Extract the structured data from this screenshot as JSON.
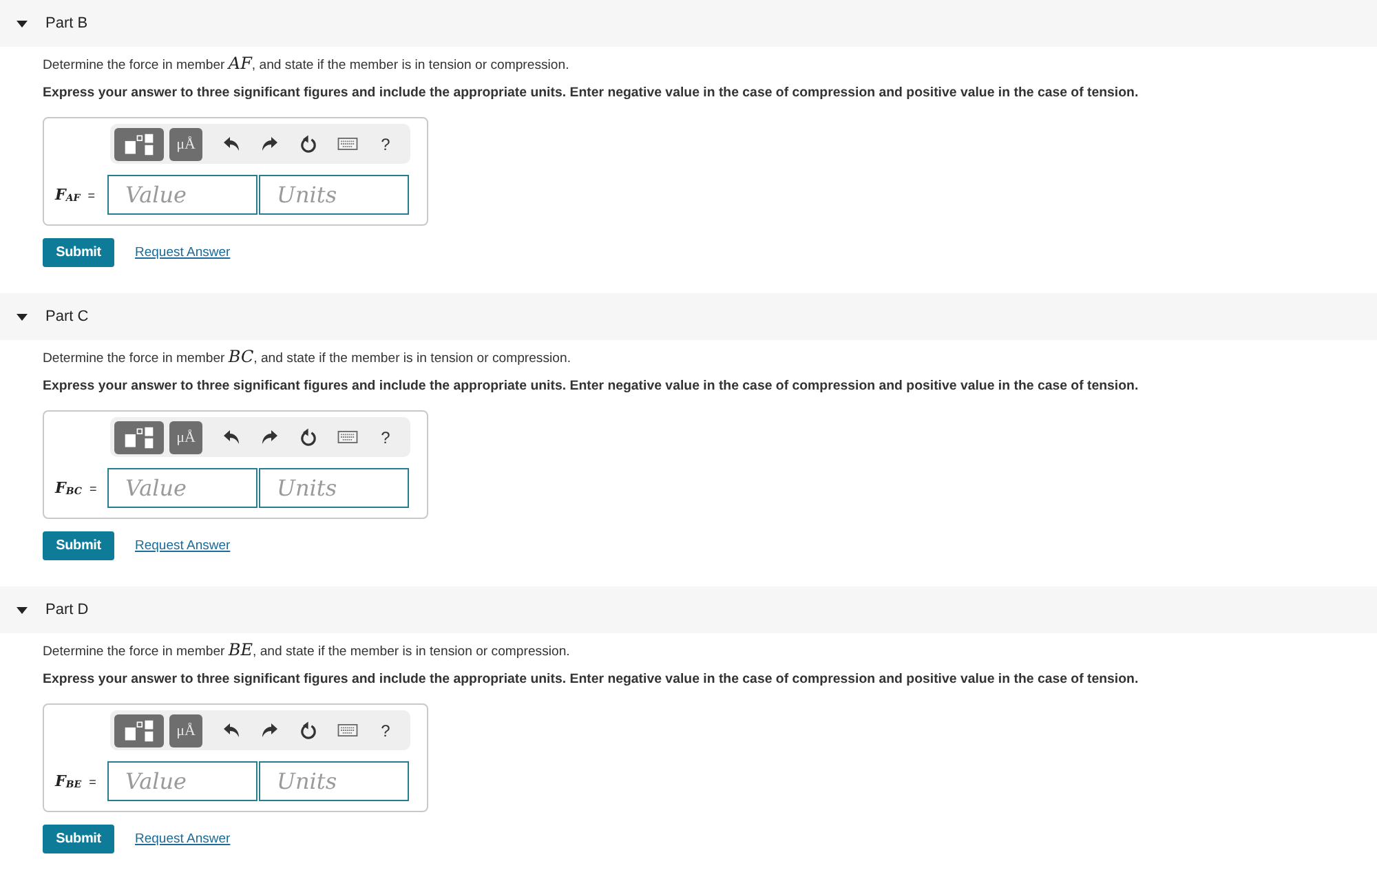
{
  "parts": [
    {
      "title": "Part B",
      "expanded": true,
      "question": "Determine the force in member *AF*, and state if the member is in tension or compression.",
      "instruction": "Express your answer to three significant figures and include the appropriate units. Enter negative value in the case of compression and positive value in the case of tension.",
      "answer": {
        "toolbar": [
          {
            "kind": "templates"
          },
          {
            "kind": "symbols",
            "label": "μÅ"
          },
          {
            "kind": "undo"
          },
          {
            "kind": "redo"
          },
          {
            "kind": "reset"
          },
          {
            "kind": "keyboard"
          },
          {
            "kind": "help",
            "label": "?"
          }
        ],
        "label": "*F*$_{AF}$ =",
        "value_placeholder": "Value",
        "units_placeholder": "Units"
      },
      "submit": "Submit",
      "request_answer": "Request Answer"
    },
    {
      "title": "Part C",
      "expanded": true,
      "question": "Determine the force in member *BC*, and state if the member is in tension or compression.",
      "instruction": "Express your answer to three significant figures and include the appropriate units. Enter negative value in the case of compression and positive value in the case of tension.",
      "answer": {
        "toolbar": [
          {
            "kind": "templates"
          },
          {
            "kind": "symbols",
            "label": "μÅ"
          },
          {
            "kind": "undo"
          },
          {
            "kind": "redo"
          },
          {
            "kind": "reset"
          },
          {
            "kind": "keyboard"
          },
          {
            "kind": "help",
            "label": "?"
          }
        ],
        "label": "*F*$_{BC}$ =",
        "value_placeholder": "Value",
        "units_placeholder": "Units"
      },
      "submit": "Submit",
      "request_answer": "Request Answer"
    },
    {
      "title": "Part D",
      "expanded": true,
      "question": "Determine the force in member *BE*, and state if the member is in tension or compression.",
      "instruction": "Express your answer to three significant figures and include the appropriate units. Enter negative value in the case of compression and positive value in the case of tension.",
      "answer": {
        "toolbar": [
          {
            "kind": "templates"
          },
          {
            "kind": "symbols",
            "label": "μÅ"
          },
          {
            "kind": "undo"
          },
          {
            "kind": "redo"
          },
          {
            "kind": "reset"
          },
          {
            "kind": "keyboard"
          },
          {
            "kind": "help",
            "label": "?"
          }
        ],
        "label": "*F*$_{BE}$ =",
        "value_placeholder": "Value",
        "units_placeholder": "Units"
      },
      "submit": "Submit",
      "request_answer": "Request Answer"
    }
  ]
}
